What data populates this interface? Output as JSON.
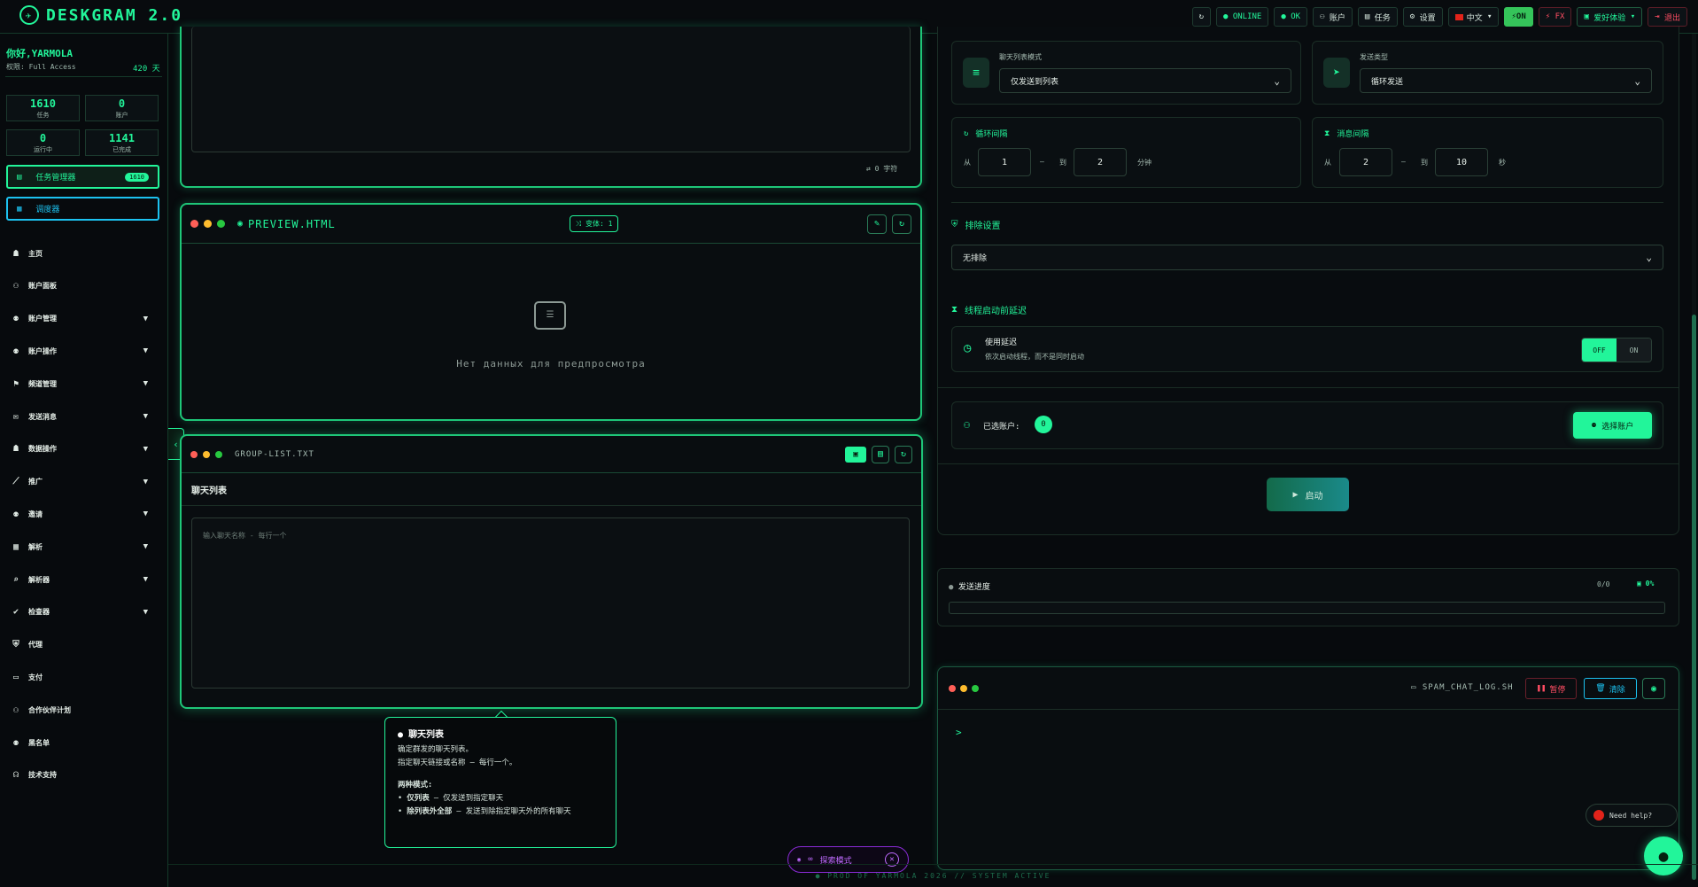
{
  "topbar": {
    "app_name": "DESKGRAM 2.0",
    "refresh_icon": "↻",
    "online": "● ONLINE",
    "ok": "● OK",
    "accounts": "账户",
    "tasks": "任务",
    "settings": "设置",
    "language": "中文",
    "on_label": "ON",
    "fx_label": "FX",
    "report": "爱好体验",
    "logout": "退出"
  },
  "sidebar": {
    "greeting": "你好,YARMOLA",
    "access": "权限: Full Access",
    "days": "420 天",
    "stats": [
      {
        "value": "1610",
        "label": "任务"
      },
      {
        "value": "0",
        "label": "账户"
      },
      {
        "value": "0",
        "label": "运行中"
      },
      {
        "value": "1141",
        "label": "已完成"
      }
    ],
    "task_manager": {
      "label": "任务管理器",
      "badge": "1610"
    },
    "calendar_btn": "调度器",
    "nav": [
      {
        "icon": "☗",
        "label": "主页",
        "arrow": false
      },
      {
        "icon": "⚇",
        "label": "账户面板",
        "arrow": false
      },
      {
        "icon": "⚉",
        "label": "账户管理",
        "arrow": true
      },
      {
        "icon": "⚉",
        "label": "账户操作",
        "arrow": true
      },
      {
        "icon": "⚑",
        "label": "频道管理",
        "arrow": true
      },
      {
        "icon": "✉",
        "label": "发送消息",
        "arrow": true
      },
      {
        "icon": "☗",
        "label": "数据操作",
        "arrow": true
      },
      {
        "icon": "⟋",
        "label": "推广",
        "arrow": true
      },
      {
        "icon": "⚉",
        "label": "邀请",
        "arrow": true
      },
      {
        "icon": "▦",
        "label": "解析",
        "arrow": true
      },
      {
        "icon": "⌕",
        "label": "解析器",
        "arrow": true
      },
      {
        "icon": "✔",
        "label": "检查器",
        "arrow": true
      },
      {
        "icon": "⛨",
        "label": "代理",
        "arrow": false
      },
      {
        "icon": "▭",
        "label": "支付",
        "arrow": false
      },
      {
        "icon": "⚇",
        "label": "合作伙伴计划",
        "arrow": false
      },
      {
        "icon": "⚉",
        "label": "黑名单",
        "arrow": false
      },
      {
        "icon": "☊",
        "label": "技术支持",
        "arrow": false
      }
    ]
  },
  "editor": {
    "char_count": "0 字符"
  },
  "preview": {
    "title": "PREVIEW.HTML",
    "variant_badge": "变体: 1",
    "empty_text": "Нет данных для предпросмотра"
  },
  "group_list": {
    "file_name": "GROUP-LIST.TXT",
    "section_title": "聊天列表",
    "placeholder": "输入聊天名称 - 每行一个"
  },
  "tooltip": {
    "title": "聊天列表",
    "lines": [
      "确定群发的聊天列表。",
      "指定聊天链接或名称 — 每行一个。"
    ],
    "modes_title": "两种模式:",
    "mode1_bold": "仅列表",
    "mode1_text": " — 仅发送到指定聊天",
    "mode2_bold": "除列表外全部",
    "mode2_text": " — 发送到除指定聊天外的所有聊天"
  },
  "explore_mode": "探索模式",
  "settings": {
    "list_mode_label": "聊天列表模式",
    "list_mode_value": "仅发送到列表",
    "send_type_label": "发送类型",
    "send_type_value": "循环发送",
    "cycle_label": "循环间隔",
    "cycle_from_label": "从",
    "cycle_from": "1",
    "cycle_dash": "—",
    "cycle_to_label": "到",
    "cycle_to": "2",
    "cycle_unit": "分钟",
    "msg_label": "消息间隔",
    "msg_from_label": "从",
    "msg_from": "2",
    "msg_dash": "—",
    "msg_to_label": "到",
    "msg_to": "10",
    "msg_unit": "秒",
    "exclude_title": "排除设置",
    "exclude_value": "无排除",
    "delay_title": "线程启动前延迟",
    "delay_use": "使用延迟",
    "delay_desc": "依次启动线程，而不是同时启动",
    "toggle_off": "OFF",
    "toggle_on": "ON",
    "selected_accounts": "已选账户:",
    "selected_count": "0",
    "select_accounts_btn": "选择账户",
    "start_btn": "启动"
  },
  "progress": {
    "label": "发送进度",
    "counter": "0/0",
    "percent": "0%"
  },
  "log": {
    "file_name": "SPAM_CHAT_LOG.SH",
    "pause_btn": "暂停",
    "clear_btn": "清除",
    "prompt": ">"
  },
  "need_help": "Need help?",
  "footer": "● PROD OF YARMOLA 2026   // SYSTEM ACTIVE"
}
